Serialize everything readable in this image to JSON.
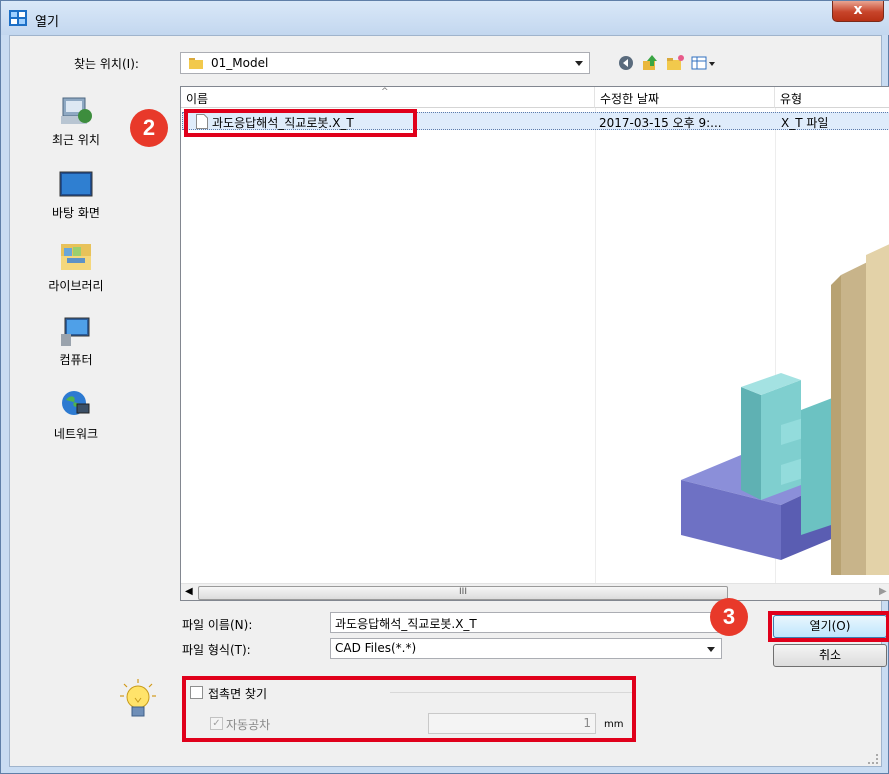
{
  "window": {
    "title": "열기",
    "close_glyph": "x"
  },
  "lookin": {
    "label": "찾는 위치(I):",
    "value": "01_Model"
  },
  "toolbar": {
    "icons": [
      "back-icon",
      "up-folder-icon",
      "new-folder-icon",
      "view-menu-icon"
    ]
  },
  "places": [
    {
      "label": "최근 위치",
      "icon": "recent-places-icon"
    },
    {
      "label": "바탕 화면",
      "icon": "desktop-icon"
    },
    {
      "label": "라이브러리",
      "icon": "libraries-icon"
    },
    {
      "label": "컴퓨터",
      "icon": "computer-icon"
    },
    {
      "label": "네트워크",
      "icon": "network-icon"
    }
  ],
  "filelist": {
    "columns": [
      "이름",
      "수정한 날짜",
      "유형"
    ],
    "rows": [
      {
        "name": "과도응답해석_직교로봇.X_T",
        "modified": "2017-03-15 오후 9:...",
        "type": "X_T 파일"
      }
    ],
    "scroll_glyph": "III"
  },
  "filename": {
    "label": "파일 이름(N):",
    "value": "과도응답해석_직교로봇.X_T"
  },
  "filetype": {
    "label": "파일 형식(T):",
    "value": "CAD Files(*.*)"
  },
  "buttons": {
    "open": "열기(O)",
    "cancel": "취소"
  },
  "options": {
    "contact_label": "접촉면 찾기",
    "tolerance_label": "자동공차",
    "tolerance_value": "1",
    "tolerance_unit": "mm"
  },
  "annotations": {
    "badge2": "2",
    "badge3": "3"
  },
  "colors": {
    "highlight": "#e0001b",
    "badge": "#e8392a",
    "selection": "#dfecfb"
  }
}
